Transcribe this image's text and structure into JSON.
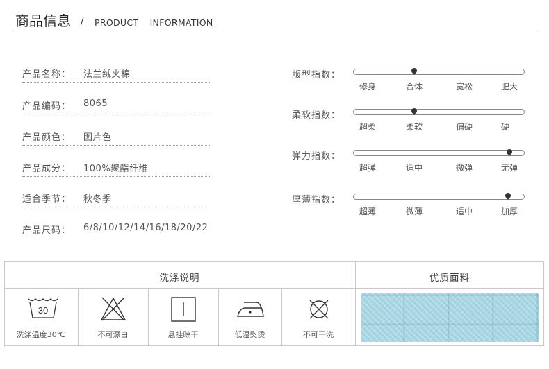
{
  "header": {
    "title": "商品信息",
    "slash": "/",
    "subtitle": "PRODUCT INFORMATION"
  },
  "info": [
    {
      "label": "产品名称：",
      "value": "法兰绒夹棉"
    },
    {
      "label": "产品编码：",
      "value": "8065"
    },
    {
      "label": "产品颜色：",
      "value": "图片色"
    },
    {
      "label": "产品成分：",
      "value": "100%聚酯纤维"
    },
    {
      "label": "适合季节：",
      "value": "秋冬季"
    },
    {
      "label": "产品尺码：",
      "value": "6/8/10/12/14/16/18/20/22"
    }
  ],
  "indices": [
    {
      "label": "版型指数：",
      "ticks": [
        "修身",
        "合体",
        "宽松",
        "肥大"
      ],
      "selected": "合体"
    },
    {
      "label": "柔软指数：",
      "ticks": [
        "超柔",
        "柔软",
        "偏硬",
        "硬"
      ],
      "selected": "柔软"
    },
    {
      "label": "弹力指数：",
      "ticks": [
        "超弹",
        "适中",
        "微弹",
        "无弹"
      ],
      "selected": "无弹"
    },
    {
      "label": "厚薄指数：",
      "ticks": [
        "超薄",
        "微薄",
        "适中",
        "加厚"
      ],
      "selected": "加厚"
    }
  ],
  "care": {
    "title": "洗涤说明",
    "items": [
      {
        "icon": "wash-30-icon",
        "label": "洗涤温度30℃",
        "temp": "30"
      },
      {
        "icon": "no-bleach-icon",
        "label": "不可漂白"
      },
      {
        "icon": "hang-dry-icon",
        "label": "悬挂晾干"
      },
      {
        "icon": "low-iron-icon",
        "label": "低温熨烫"
      },
      {
        "icon": "no-dryclean-icon",
        "label": "不可干洗"
      }
    ]
  },
  "fabric": {
    "title": "优质面料"
  }
}
